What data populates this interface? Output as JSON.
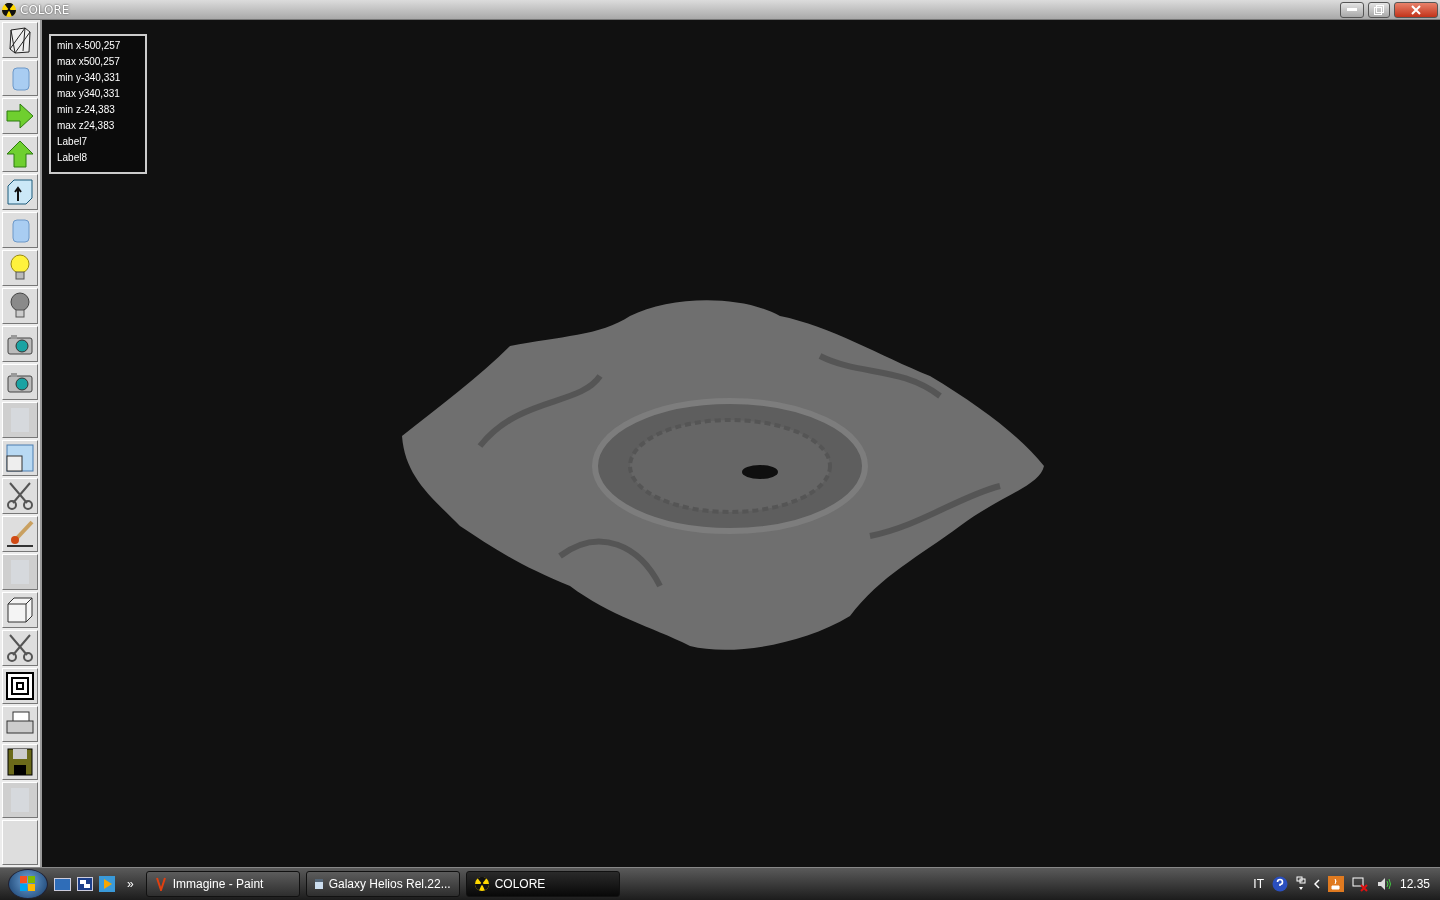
{
  "window": {
    "title": "COLORE"
  },
  "toolbar": [
    {
      "kind": "wireframe",
      "disabled": false
    },
    {
      "kind": "cylinder",
      "disabled": false
    },
    {
      "kind": "arrow-right",
      "disabled": false
    },
    {
      "kind": "arrow-up",
      "disabled": false
    },
    {
      "kind": "cube-arrow",
      "disabled": false
    },
    {
      "kind": "cylinder",
      "disabled": false
    },
    {
      "kind": "bulb-on",
      "disabled": false
    },
    {
      "kind": "bulb-off",
      "disabled": false
    },
    {
      "kind": "camera",
      "disabled": false
    },
    {
      "kind": "camera",
      "disabled": false
    },
    {
      "kind": "blank",
      "disabled": true
    },
    {
      "kind": "window",
      "disabled": false
    },
    {
      "kind": "scissors",
      "disabled": false
    },
    {
      "kind": "brush",
      "disabled": false
    },
    {
      "kind": "blank",
      "disabled": true
    },
    {
      "kind": "cube",
      "disabled": false
    },
    {
      "kind": "scissors",
      "disabled": false
    },
    {
      "kind": "squares",
      "disabled": false
    },
    {
      "kind": "printer",
      "disabled": false
    },
    {
      "kind": "floppy",
      "disabled": false
    },
    {
      "kind": "blank",
      "disabled": true
    },
    {
      "kind": "empty",
      "disabled": false
    }
  ],
  "info_labels": [
    "min x-500,257",
    "max x500,257",
    "min y-340,331",
    "max y340,331",
    "min z-24,383",
    "max z24,383",
    "Label7",
    "Label8"
  ],
  "taskbar": {
    "overflow": "»",
    "buttons": [
      {
        "label": "Immagine - Paint",
        "kind": "paint",
        "selected": false
      },
      {
        "label": "Galaxy Helios  Rel.22...",
        "kind": "helios",
        "selected": false
      },
      {
        "label": "COLORE",
        "kind": "radiation",
        "selected": true
      }
    ],
    "language": "IT",
    "clock": "12.35"
  }
}
